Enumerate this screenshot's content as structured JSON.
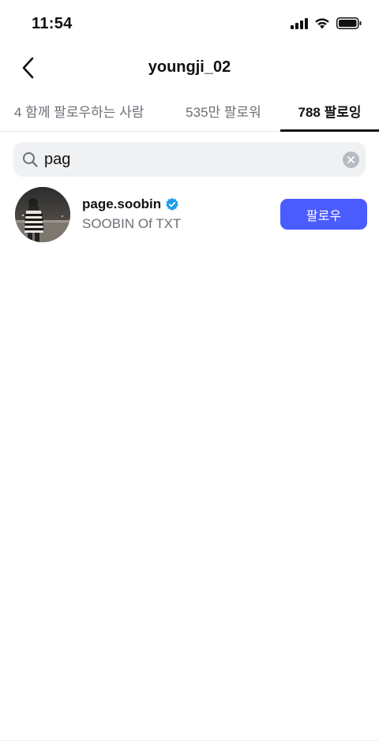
{
  "status_bar": {
    "time": "11:54",
    "icons": [
      "cellular-signal-icon",
      "wifi-icon",
      "battery-icon"
    ]
  },
  "header": {
    "title": "youngji_02",
    "back_icon": "chevron-left-icon"
  },
  "tabs": [
    {
      "label": "4 함께 팔로우하는 사람",
      "active": false
    },
    {
      "label": "535만 팔로워",
      "active": false
    },
    {
      "label": "788 팔로잉",
      "active": true
    }
  ],
  "search": {
    "value": "pag",
    "icon": "search-icon",
    "clear_icon": "clear-icon"
  },
  "results": [
    {
      "username": "page.soobin",
      "verified": true,
      "display_name": "SOOBIN Of TXT",
      "follow_label": "팔로우"
    }
  ],
  "colors": {
    "accent": "#4b5cff",
    "verified": "#1d9bf0",
    "search_bg": "#eff1f3",
    "muted_text": "#6b6f75"
  }
}
